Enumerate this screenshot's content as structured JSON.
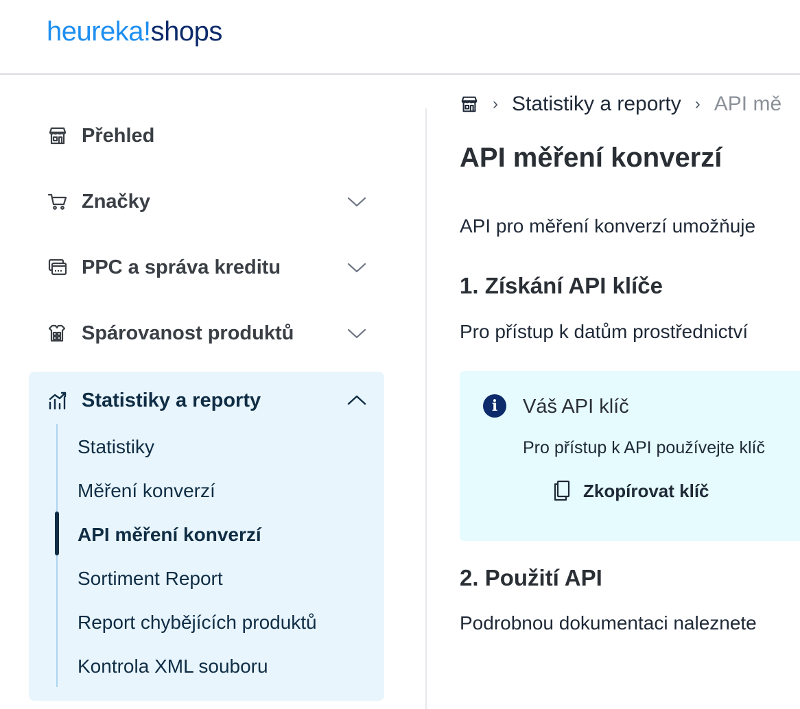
{
  "header": {
    "logo_part1": "heureka!",
    "logo_part2": "shops"
  },
  "sidebar": {
    "items": [
      {
        "label": "Přehled",
        "icon": "store-icon",
        "has_chevron": false
      },
      {
        "label": "Značky",
        "icon": "cart-icon",
        "has_chevron": true
      },
      {
        "label": "PPC a správa kreditu",
        "icon": "credit-icon",
        "has_chevron": true
      },
      {
        "label": "Spárovanost produktů",
        "icon": "products-icon",
        "has_chevron": true
      }
    ],
    "active_group": {
      "label": "Statistiky a reporty",
      "icon": "chart-icon",
      "expanded": true,
      "subitems": [
        {
          "label": "Statistiky",
          "active": false
        },
        {
          "label": "Měření konverzí",
          "active": false
        },
        {
          "label": "API měření konverzí",
          "active": true
        },
        {
          "label": "Sortiment Report",
          "active": false
        },
        {
          "label": "Report chybějících produktů",
          "active": false
        },
        {
          "label": "Kontrola XML souboru",
          "active": false
        }
      ]
    }
  },
  "breadcrumb": {
    "items": [
      "Statistiky a reporty"
    ],
    "current": "API mě"
  },
  "main": {
    "title": "API měření konverzí",
    "intro": "API pro měření konverzí umožňuje",
    "section1_title": "1. Získání API klíče",
    "section1_text": "Pro přístup k datům prostřednictví",
    "info_box": {
      "title": "Váš API klíč",
      "text": "Pro přístup k API používejte klíč",
      "copy_label": "Zkopírovat klíč"
    },
    "section2_title": "2. Použití API",
    "section2_text": "Podrobnou dokumentaci naleznete"
  },
  "colors": {
    "brand_light": "#1e8ff0",
    "brand_dark": "#0d2b6b",
    "active_bg": "#e8f5fd",
    "info_bg": "#e6fbfd"
  }
}
